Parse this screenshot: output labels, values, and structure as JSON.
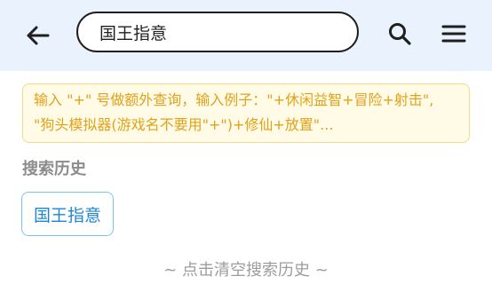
{
  "header": {
    "back_icon": "arrow-left-icon",
    "search_value": "国王指意",
    "search_icon": "search-icon",
    "menu_icon": "hamburger-menu-icon",
    "background_color": "#e9f2fd"
  },
  "tip": {
    "text": "输入 \"+\" 号做额外查询，输入例子：\"+休闲益智+冒险+射击\", \"狗头模拟器(游戏名不要用\"+\")+修仙+放置\"..."
  },
  "history": {
    "title": "搜索历史",
    "items": [
      "国王指意"
    ],
    "clear_label": "~ 点击清空搜索历史 ~"
  },
  "colors": {
    "tip_text": "#e0a21a",
    "tip_bg": "#fffbe6",
    "tag_text": "#1d86d2",
    "tag_border": "#7ec3ec"
  }
}
